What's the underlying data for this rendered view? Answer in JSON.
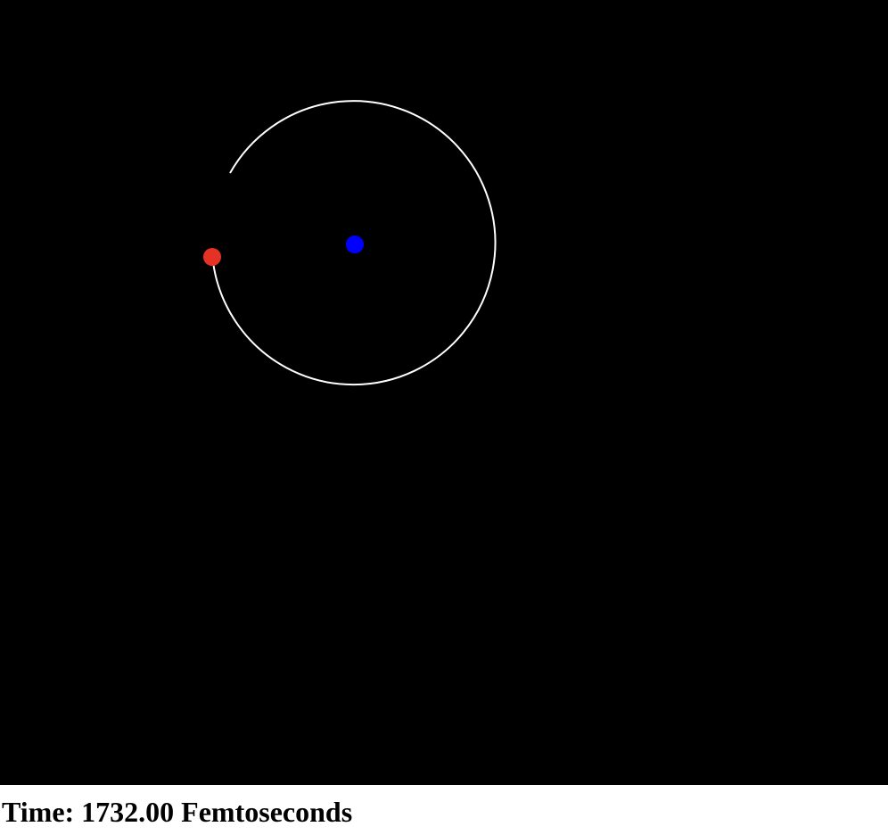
{
  "simulation": {
    "background_color": "#000000",
    "orbit_color": "#ffffff",
    "nucleus_color": "#0000ff",
    "electron_color": "#e53224"
  },
  "status": {
    "time_label": "Time:",
    "time_value": "1732.00",
    "time_unit": "Femtoseconds"
  }
}
